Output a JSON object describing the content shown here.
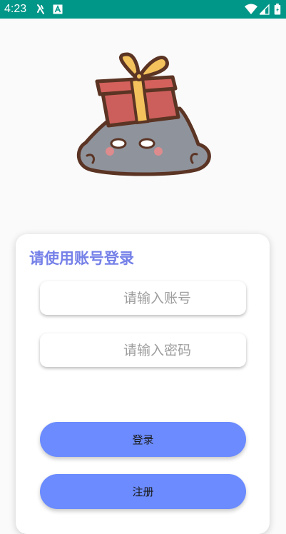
{
  "status_bar": {
    "time": "4:23",
    "icons": [
      "notification-bug-icon",
      "notification-a-icon",
      "wifi-icon",
      "signal-icon",
      "battery-icon"
    ],
    "background": "#009688"
  },
  "login": {
    "title": "请使用账号登录",
    "account_placeholder": "请输入账号",
    "password_placeholder": "请输入密码",
    "login_label": "登录",
    "register_label": "注册"
  },
  "colors": {
    "title": "#7580e8",
    "button": "#6b8bff",
    "page_background": "#fafafa"
  }
}
